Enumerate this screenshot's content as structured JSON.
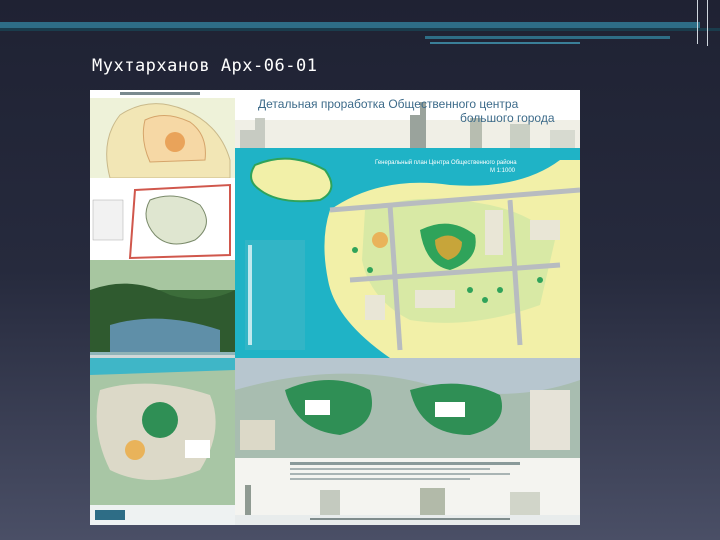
{
  "slide": {
    "title": "Мухтарханов Арх-06-01"
  },
  "poster": {
    "heading_line1": "Детальная проработка Общественного центра",
    "heading_line2": "большого города",
    "subheading_line1": "Генеральный план Центра Общественного района",
    "subheading_line2": "М 1:1000"
  },
  "colors": {
    "sea": "#1fb3c6",
    "land": "#f2f0a8",
    "green": "#2fa35a",
    "road": "#b8bcc0",
    "block": "#e9e6d6",
    "accent_top_bar": "#2e6d86"
  }
}
